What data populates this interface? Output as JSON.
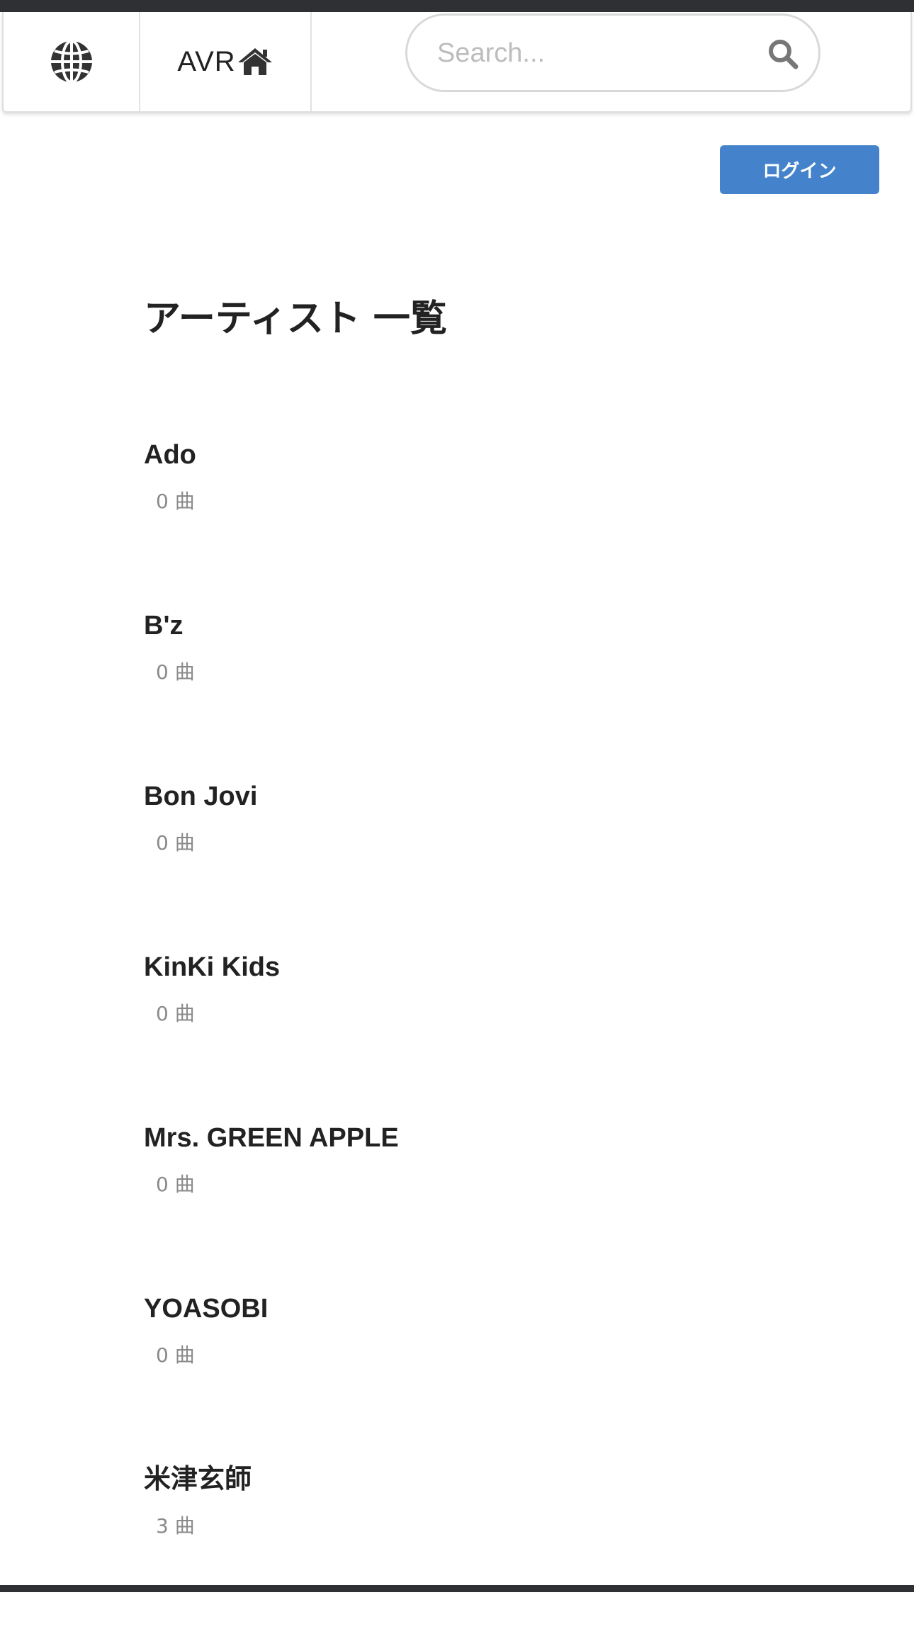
{
  "header": {
    "brand_label": "AVR",
    "globe_icon": "globe-icon",
    "home_icon": "home-icon",
    "search_placeholder": "Search...",
    "search_icon": "search-icon"
  },
  "login": {
    "label": "ログイン",
    "color": "#4483cc"
  },
  "page_title": "アーティスト 一覧",
  "artists": [
    {
      "name": "Ado",
      "count": "0 曲"
    },
    {
      "name": "B'z",
      "count": "0 曲"
    },
    {
      "name": "Bon Jovi",
      "count": "0 曲"
    },
    {
      "name": "KinKi Kids",
      "count": "0 曲"
    },
    {
      "name": "Mrs. GREEN APPLE",
      "count": "0 曲"
    },
    {
      "name": "YOASOBI",
      "count": "0 曲"
    },
    {
      "name": "米津玄師",
      "count": "3 曲"
    }
  ]
}
